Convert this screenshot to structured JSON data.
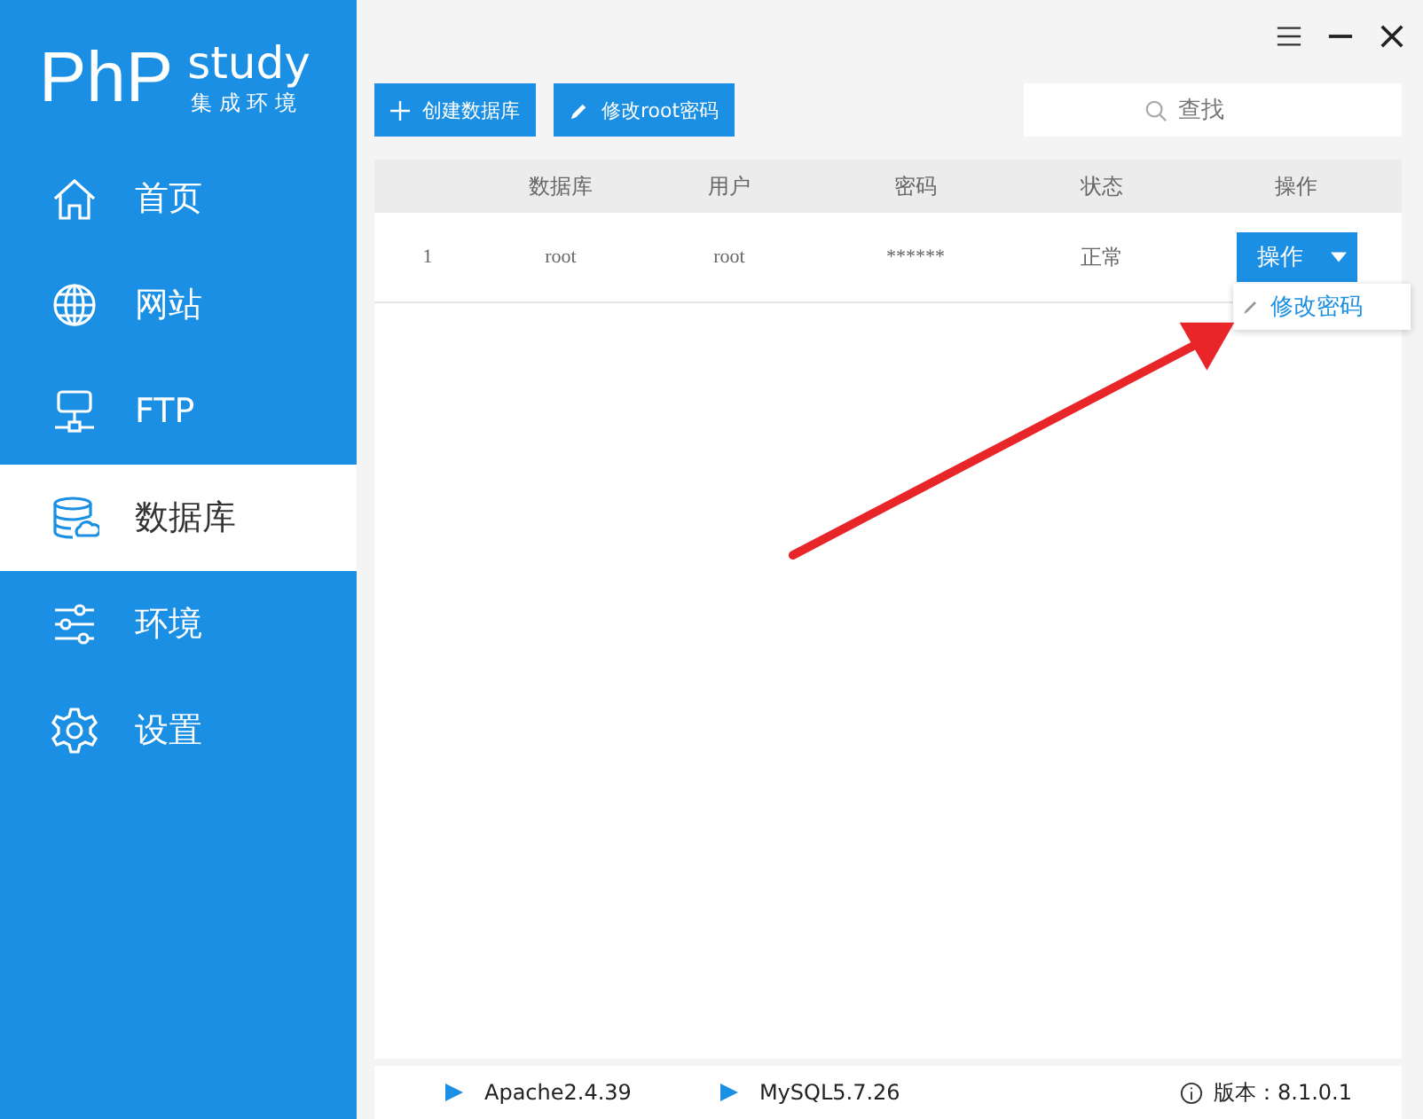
{
  "logo": {
    "title": "PhP",
    "subtitle": "study",
    "tagline": "集 成 环 境"
  },
  "sidebar": {
    "items": [
      {
        "label": "首页",
        "kind": "home",
        "selected": false
      },
      {
        "label": "网站",
        "kind": "globe",
        "selected": false
      },
      {
        "label": "FTP",
        "kind": "ftp",
        "selected": false
      },
      {
        "label": "数据库",
        "kind": "database",
        "selected": true
      },
      {
        "label": "环境",
        "kind": "sliders",
        "selected": false
      },
      {
        "label": "设置",
        "kind": "gear",
        "selected": false
      }
    ]
  },
  "toolbar": {
    "buttons": [
      {
        "label": "创建数据库",
        "kind": "create"
      },
      {
        "label": "修改root密码",
        "kind": "edit"
      }
    ],
    "search": {
      "placeholder": "查找"
    }
  },
  "table": {
    "columns": [
      "",
      "数据库",
      "用户",
      "密码",
      "状态",
      "操作"
    ],
    "rows": [
      {
        "cells": [
          "1",
          "root",
          "root",
          "******",
          "正常"
        ],
        "action": "操作"
      }
    ]
  },
  "dropdown_menu": {
    "items": [
      "修改密码"
    ]
  },
  "status_bar": {
    "services": [
      "Apache2.4.39",
      "MySQL5.7.26"
    ],
    "version": "版本：8.1.0.1"
  }
}
